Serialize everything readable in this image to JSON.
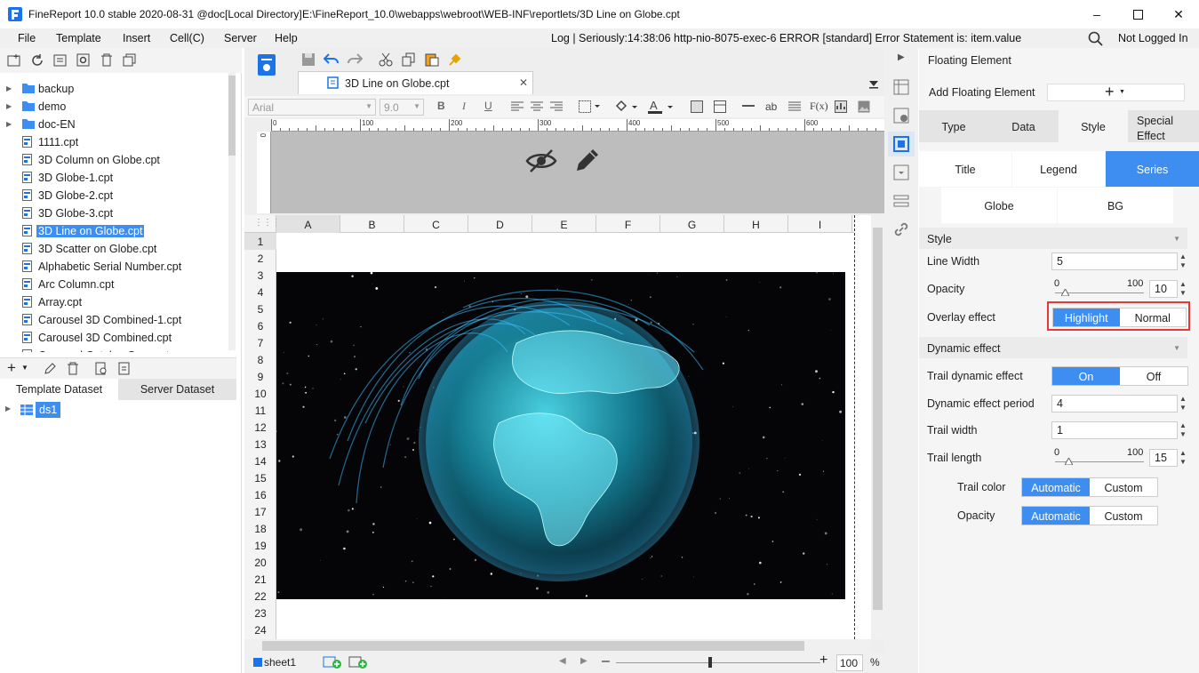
{
  "window": {
    "title": "FineReport 10.0 stable 2020-08-31 @doc[Local Directory]",
    "path": "E:\\FineReport_10.0\\webapps\\webroot\\WEB-INF\\reportlets/3D Line on Globe.cpt"
  },
  "menu": [
    "File",
    "Template",
    "Insert",
    "Cell(C)",
    "Server",
    "Help"
  ],
  "log": "Log | Seriously:14:38:06 http-nio-8075-exec-6 ERROR [standard] Error Statement is: item.value",
  "login": "Not Logged In",
  "tree": [
    {
      "label": "backup",
      "type": "folder"
    },
    {
      "label": "demo",
      "type": "folder"
    },
    {
      "label": "doc-EN",
      "type": "folder"
    },
    {
      "label": "1111.cpt",
      "type": "file"
    },
    {
      "label": "3D Column on Globe.cpt",
      "type": "file"
    },
    {
      "label": "3D Globe-1.cpt",
      "type": "file"
    },
    {
      "label": "3D Globe-2.cpt",
      "type": "file"
    },
    {
      "label": "3D Globe-3.cpt",
      "type": "file"
    },
    {
      "label": "3D Line on Globe.cpt",
      "type": "file"
    },
    {
      "label": "3D Scatter on Globe.cpt",
      "type": "file"
    },
    {
      "label": "Alphabetic Serial Number.cpt",
      "type": "file"
    },
    {
      "label": "Arc Column.cpt",
      "type": "file"
    },
    {
      "label": "Array.cpt",
      "type": "file"
    },
    {
      "label": "Carousel 3D Combined-1.cpt",
      "type": "file"
    },
    {
      "label": "Carousel 3D Combined.cpt",
      "type": "file"
    },
    {
      "label": "Carousel Catalog Gear.cpt",
      "type": "file"
    }
  ],
  "dataset": {
    "tabs": [
      "Template Dataset",
      "Server Dataset"
    ],
    "item": "ds1"
  },
  "editor": {
    "tab": "3D Line on Globe.cpt",
    "font": "Arial",
    "size": "9.0",
    "zoom": "100",
    "zoom_unit": "%",
    "sheet": "sheet1",
    "ruler": [
      "0",
      "100",
      "200",
      "300",
      "400",
      "500",
      "600"
    ],
    "columns": [
      "A",
      "B",
      "C",
      "D",
      "E",
      "F",
      "G",
      "H",
      "I"
    ],
    "rows": [
      "1",
      "2",
      "3",
      "4",
      "5",
      "6",
      "7",
      "8",
      "9",
      "10",
      "11",
      "12",
      "13",
      "14",
      "15",
      "16",
      "17",
      "18",
      "19",
      "20",
      "21",
      "22",
      "23",
      "24"
    ]
  },
  "panel": {
    "title": "Floating Element",
    "add_label": "Add Floating Element",
    "tabs": [
      "Type",
      "Data",
      "Style",
      "Special Effect"
    ],
    "subtabs": [
      "Title",
      "Legend",
      "Series"
    ],
    "subtabs2": [
      "Globe",
      "BG"
    ],
    "style_section": "Style",
    "line_width_label": "Line Width",
    "line_width": "5",
    "opacity_label": "Opacity",
    "opacity_min": "0",
    "opacity_max": "100",
    "opacity": "10",
    "overlay_label": "Overlay effect",
    "overlay_on": "Highlight",
    "overlay_off": "Normal",
    "dynamic_section": "Dynamic effect",
    "trail_label": "Trail dynamic effect",
    "trail_on": "On",
    "trail_off": "Off",
    "period_label": "Dynamic effect period",
    "period": "4",
    "trail_width_label": "Trail width",
    "trail_width": "1",
    "trail_length_label": "Trail length",
    "trail_min": "0",
    "trail_max": "100",
    "trail_length": "15",
    "trail_color_label": "Trail color",
    "auto": "Automatic",
    "custom": "Custom",
    "opacity2_label": "Opacity"
  },
  "colors": {
    "accent": "#3d8ef0",
    "highlight_box": "#e53935"
  }
}
